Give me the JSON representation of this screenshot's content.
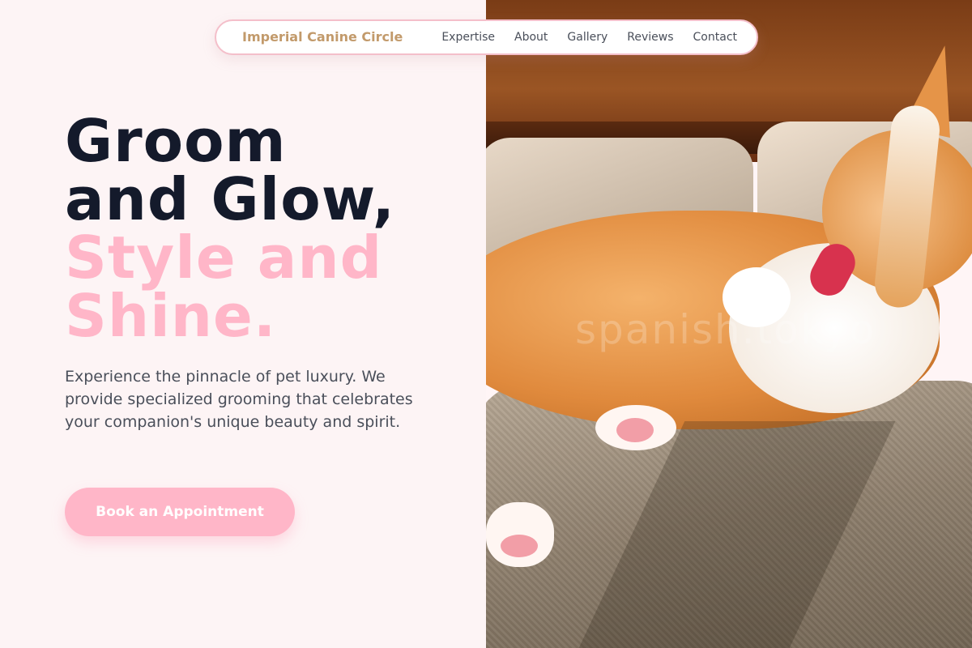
{
  "nav": {
    "brand": "Imperial Canine Circle",
    "links": [
      "Expertise",
      "About",
      "Gallery",
      "Reviews",
      "Contact"
    ]
  },
  "hero": {
    "headline_line1": "Groom",
    "headline_line2": "and Glow,",
    "headline_line3": "Style and",
    "headline_line4": "Shine.",
    "description": "Experience the pinnacle of pet luxury. We provide specialized grooming that celebrates your companion's unique beauty and spirit.",
    "cta_label": "Book an Appointment"
  },
  "photo": {
    "watermark": "spanish.tokyo"
  },
  "colors": {
    "brand": "#c29a6b",
    "accent_pink": "#ffb6c8",
    "headline_dark": "#141a2b",
    "body_text": "#4a4f5a",
    "page_background": "#fdf4f5"
  }
}
